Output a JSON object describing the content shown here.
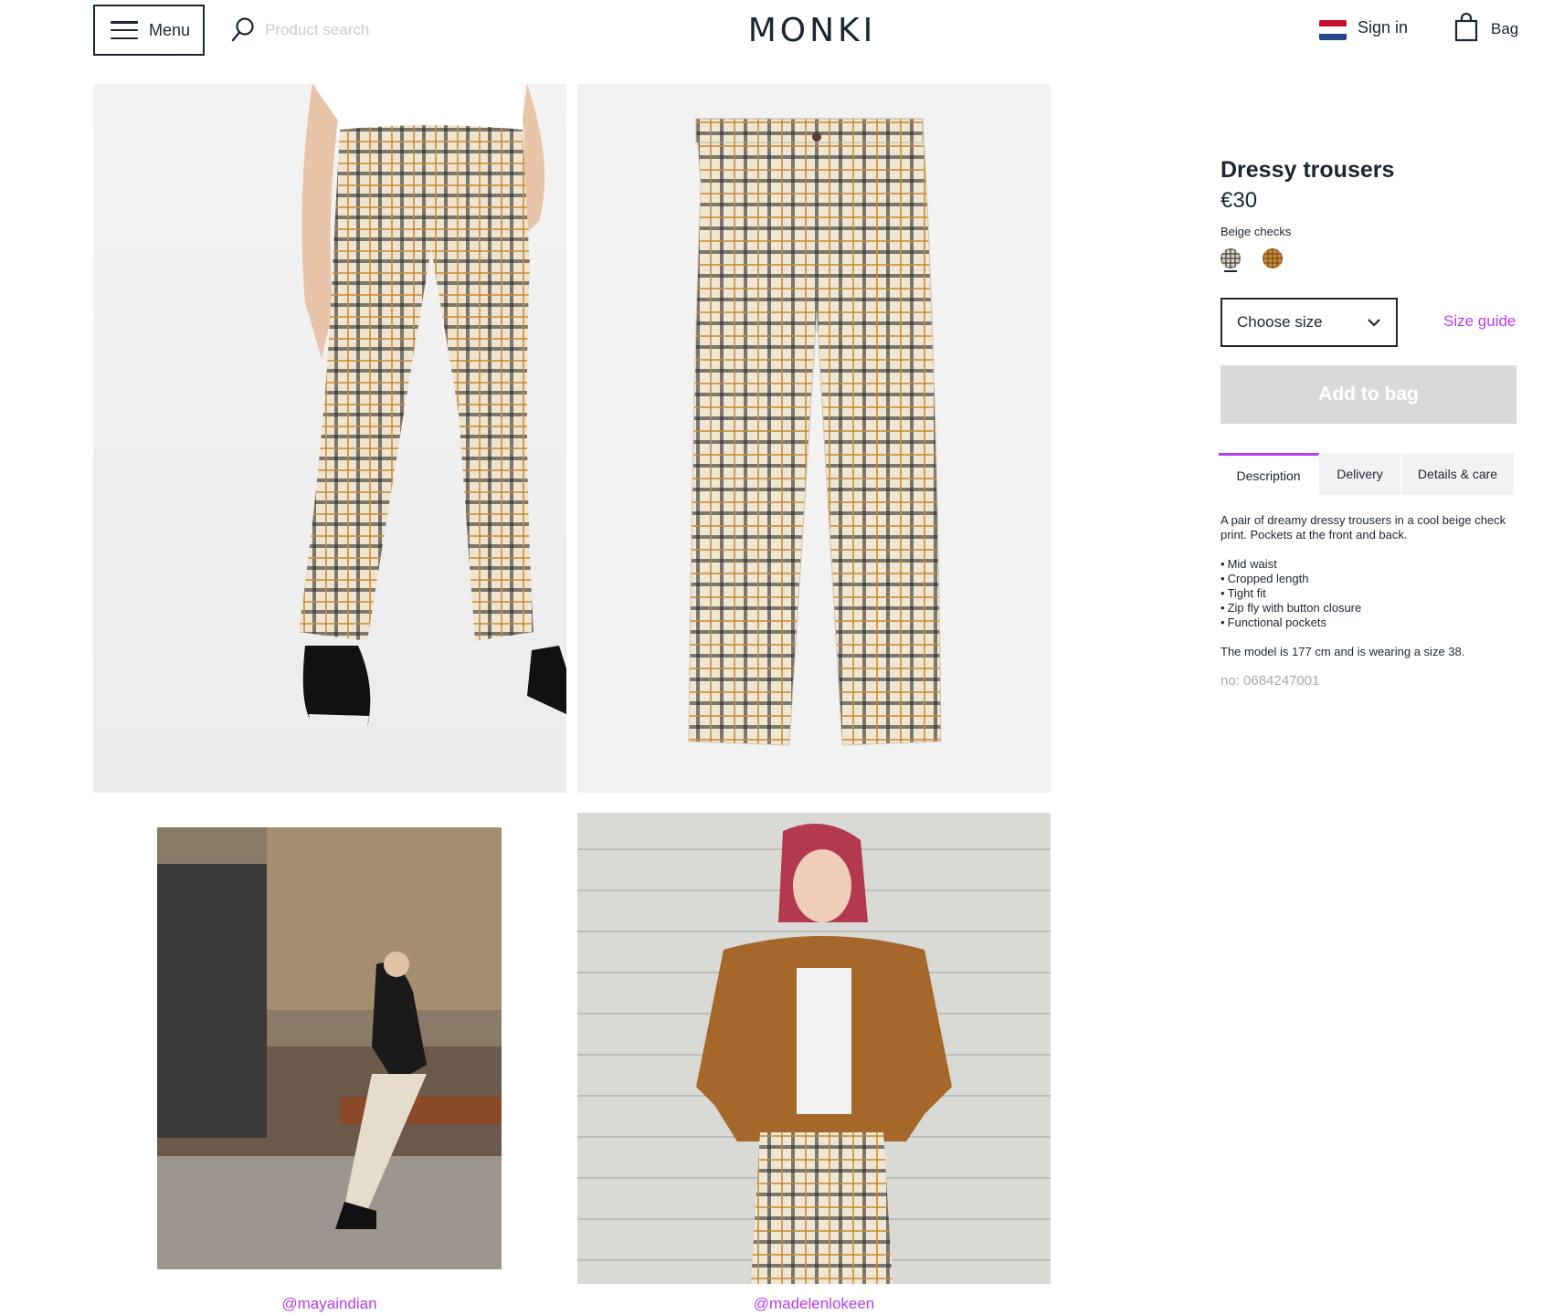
{
  "header": {
    "menu_label": "Menu",
    "search_placeholder": "Product search",
    "logo_text": "MONKI",
    "sign_in_label": "Sign in",
    "bag_label": "Bag",
    "flag_colors": [
      "#c8102e",
      "#ffffff",
      "#21468b"
    ]
  },
  "gallery": {
    "images": [
      {
        "name": "model-wearing-trousers"
      },
      {
        "name": "flat-lay-trousers"
      },
      {
        "name": "customer-photo-1"
      },
      {
        "name": "customer-photo-2"
      }
    ],
    "ugc_handles": [
      "@mayaindian",
      "@madelenlokeen"
    ]
  },
  "product": {
    "title": "Dressy trousers",
    "price": "€30",
    "color_name": "Beige checks",
    "swatches": [
      {
        "name": "beige-checks",
        "selected": true
      },
      {
        "name": "brown-checks",
        "selected": false
      }
    ],
    "size_select_label": "Choose size",
    "size_guide_label": "Size guide",
    "add_to_bag_label": "Add to bag",
    "tabs": [
      {
        "label": "Description",
        "active": true
      },
      {
        "label": "Delivery",
        "active": false
      },
      {
        "label": "Details & care",
        "active": false
      }
    ],
    "description": {
      "intro": "A pair of dreamy dressy trousers in a cool beige check print. Pockets at the front and back.",
      "bullets": [
        "Mid waist",
        "Cropped length",
        "Tight fit",
        "Zip fly with button closure",
        "Functional pockets"
      ],
      "model_info": "The model is 177 cm and is wearing a size 38.",
      "product_number": "no: 0684247001"
    }
  },
  "colors": {
    "accent": "#b83cf0",
    "text": "#1d2630",
    "button_disabled": "#d7d9da"
  }
}
